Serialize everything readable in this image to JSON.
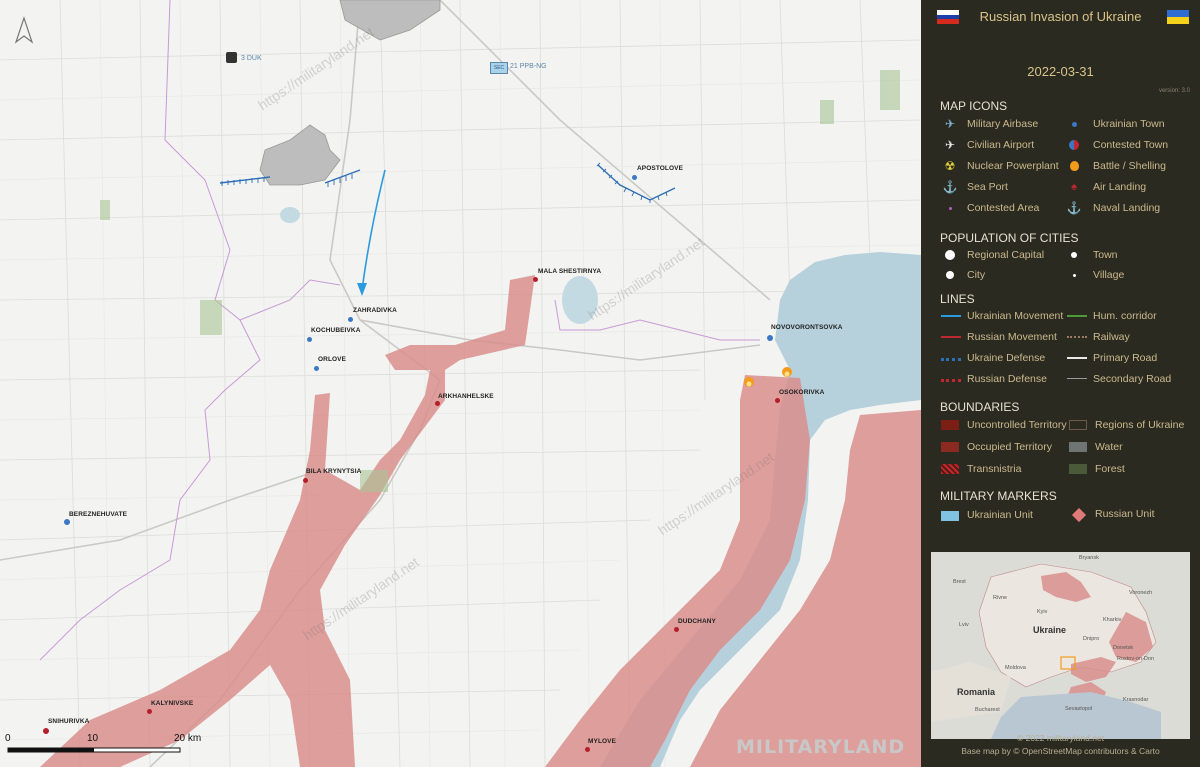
{
  "header": {
    "title": "Russian Invasion of Ukraine",
    "date": "2022-03-31",
    "version": "version: 3.0"
  },
  "colors": {
    "panel_bg": "#2b2a20",
    "panel_text": "#d8c48a",
    "occupied": "#d98e8c",
    "water": "#b6d0dc",
    "ukrainian_town": "#3a78c6",
    "russian_town": "#b3202a",
    "ukraine_defense": "#2d6fb5",
    "uncontrolled": "#7a1e16"
  },
  "legend": {
    "map_icons": {
      "heading": "MAP ICONS",
      "items": [
        {
          "label": "Military Airbase",
          "icon": "military-airbase-icon"
        },
        {
          "label": "Ukrainian Town",
          "icon": "ukrainian-town-icon"
        },
        {
          "label": "Civilian Airport",
          "icon": "civilian-airport-icon"
        },
        {
          "label": "Contested Town",
          "icon": "contested-town-icon"
        },
        {
          "label": "Nuclear Powerplant",
          "icon": "nuclear-icon"
        },
        {
          "label": "Battle / Shelling",
          "icon": "fire-icon"
        },
        {
          "label": "Sea Port",
          "icon": "anchor-icon"
        },
        {
          "label": "Air Landing",
          "icon": "parachute-icon"
        },
        {
          "label": "Contested Area",
          "icon": "contested-area-icon"
        },
        {
          "label": "Naval Landing",
          "icon": "naval-landing-icon"
        }
      ]
    },
    "population": {
      "heading": "POPULATION OF CITIES",
      "items": [
        "Regional Capital",
        "Town",
        "City",
        "Village"
      ]
    },
    "lines": {
      "heading": "LINES",
      "items": [
        "Ukrainian Movement",
        "Hum. corridor",
        "Russian Movement",
        "Railway",
        "Ukraine Defense",
        "Primary Road",
        "Russian Defense",
        "Secondary Road"
      ]
    },
    "boundaries": {
      "heading": "BOUNDARIES",
      "items": [
        "Uncontrolled Territory",
        "Regions of Ukraine",
        "Occupied Territory",
        "Water",
        "Transnistria",
        "Forest"
      ]
    },
    "military_markers": {
      "heading": "MILITARY MARKERS",
      "items": [
        "Ukrainian Unit",
        "Russian Unit"
      ]
    }
  },
  "footer": {
    "copyright": "© 2022 militaryland.net",
    "basemap": "Base map by © OpenStreetMap contributors & Carto"
  },
  "map": {
    "towns": [
      {
        "name": "MALA SHESTIRNYA",
        "side": "russian"
      },
      {
        "name": "ZAHRADIVKA",
        "side": "ukrainian"
      },
      {
        "name": "KOCHUBEIVKA",
        "side": "ukrainian"
      },
      {
        "name": "ORLOVE",
        "side": "ukrainian"
      },
      {
        "name": "ARKHANHELSKE",
        "side": "russian"
      },
      {
        "name": "APOSTOLOVE",
        "side": "ukrainian"
      },
      {
        "name": "NOVOVORONTSOVKA",
        "side": "ukrainian"
      },
      {
        "name": "OSOKORIVKA",
        "side": "russian"
      },
      {
        "name": "BILA KRYNYTSIA",
        "side": "russian"
      },
      {
        "name": "BEREZNEHUVATE",
        "side": "ukrainian"
      },
      {
        "name": "DUDCHANY",
        "side": "russian"
      },
      {
        "name": "KALYNIVSKE",
        "side": "russian"
      },
      {
        "name": "SNIHURIVKA",
        "side": "russian"
      },
      {
        "name": "MYLOVE",
        "side": "russian"
      }
    ],
    "units": [
      {
        "label": "3 DUK"
      },
      {
        "label": "21 PPB-NG",
        "badge": "SEC"
      }
    ],
    "scale": {
      "labels": [
        "0",
        "10",
        "20 km"
      ]
    },
    "watermark": "https://militaryland.net",
    "logo": "MILITARYLAND"
  },
  "inset": {
    "labels": [
      "Bryansk",
      "Brest",
      "Rivne",
      "Kyiv",
      "Kharkiv",
      "Voronezh",
      "Lviv",
      "Ukraine",
      "Dnipro",
      "Donetsk",
      "Rostov-on-Don",
      "Moldova",
      "Romania",
      "Bucharest",
      "Sevastopol",
      "Krasnodar"
    ]
  }
}
